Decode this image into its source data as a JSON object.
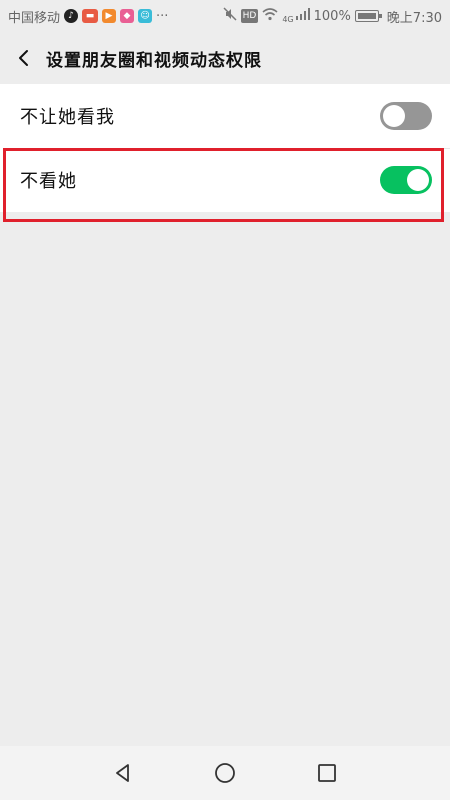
{
  "status_bar": {
    "carrier": "中国移动",
    "more": "···",
    "network": "4G",
    "battery_percent": "100%",
    "time": "晚上7:30",
    "hd_label": "HD",
    "icons": [
      "tiktok-icon",
      "red-app-icon",
      "orange-play-icon",
      "pink-app-icon",
      "cyan-app-icon",
      "mute-icon",
      "wifi-icon",
      "signal-icon",
      "battery-icon"
    ]
  },
  "header": {
    "title": "设置朋友圈和视频动态权限",
    "back_icon": "chevron-left-icon"
  },
  "settings": {
    "items": [
      {
        "label": "不让她看我",
        "enabled": false
      },
      {
        "label": "不看她",
        "enabled": true
      }
    ]
  },
  "colors": {
    "toggle_on": "#07c160",
    "toggle_off": "#969696",
    "highlight": "#e0202c",
    "background": "#ededed"
  },
  "nav_bar": {
    "icons": [
      "back-triangle-icon",
      "home-circle-icon",
      "recents-square-icon"
    ]
  }
}
